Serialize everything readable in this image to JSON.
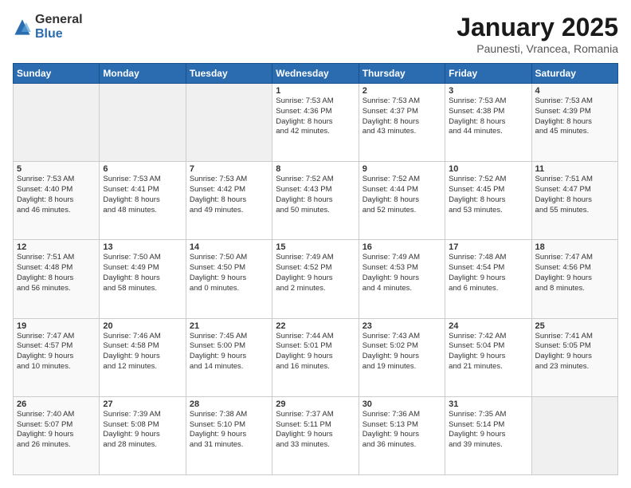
{
  "logo": {
    "general": "General",
    "blue": "Blue"
  },
  "title": {
    "month": "January 2025",
    "location": "Paunesti, Vrancea, Romania"
  },
  "weekdays": [
    "Sunday",
    "Monday",
    "Tuesday",
    "Wednesday",
    "Thursday",
    "Friday",
    "Saturday"
  ],
  "weeks": [
    [
      {
        "day": "",
        "info": ""
      },
      {
        "day": "",
        "info": ""
      },
      {
        "day": "",
        "info": ""
      },
      {
        "day": "1",
        "info": "Sunrise: 7:53 AM\nSunset: 4:36 PM\nDaylight: 8 hours\nand 42 minutes."
      },
      {
        "day": "2",
        "info": "Sunrise: 7:53 AM\nSunset: 4:37 PM\nDaylight: 8 hours\nand 43 minutes."
      },
      {
        "day": "3",
        "info": "Sunrise: 7:53 AM\nSunset: 4:38 PM\nDaylight: 8 hours\nand 44 minutes."
      },
      {
        "day": "4",
        "info": "Sunrise: 7:53 AM\nSunset: 4:39 PM\nDaylight: 8 hours\nand 45 minutes."
      }
    ],
    [
      {
        "day": "5",
        "info": "Sunrise: 7:53 AM\nSunset: 4:40 PM\nDaylight: 8 hours\nand 46 minutes."
      },
      {
        "day": "6",
        "info": "Sunrise: 7:53 AM\nSunset: 4:41 PM\nDaylight: 8 hours\nand 48 minutes."
      },
      {
        "day": "7",
        "info": "Sunrise: 7:53 AM\nSunset: 4:42 PM\nDaylight: 8 hours\nand 49 minutes."
      },
      {
        "day": "8",
        "info": "Sunrise: 7:52 AM\nSunset: 4:43 PM\nDaylight: 8 hours\nand 50 minutes."
      },
      {
        "day": "9",
        "info": "Sunrise: 7:52 AM\nSunset: 4:44 PM\nDaylight: 8 hours\nand 52 minutes."
      },
      {
        "day": "10",
        "info": "Sunrise: 7:52 AM\nSunset: 4:45 PM\nDaylight: 8 hours\nand 53 minutes."
      },
      {
        "day": "11",
        "info": "Sunrise: 7:51 AM\nSunset: 4:47 PM\nDaylight: 8 hours\nand 55 minutes."
      }
    ],
    [
      {
        "day": "12",
        "info": "Sunrise: 7:51 AM\nSunset: 4:48 PM\nDaylight: 8 hours\nand 56 minutes."
      },
      {
        "day": "13",
        "info": "Sunrise: 7:50 AM\nSunset: 4:49 PM\nDaylight: 8 hours\nand 58 minutes."
      },
      {
        "day": "14",
        "info": "Sunrise: 7:50 AM\nSunset: 4:50 PM\nDaylight: 9 hours\nand 0 minutes."
      },
      {
        "day": "15",
        "info": "Sunrise: 7:49 AM\nSunset: 4:52 PM\nDaylight: 9 hours\nand 2 minutes."
      },
      {
        "day": "16",
        "info": "Sunrise: 7:49 AM\nSunset: 4:53 PM\nDaylight: 9 hours\nand 4 minutes."
      },
      {
        "day": "17",
        "info": "Sunrise: 7:48 AM\nSunset: 4:54 PM\nDaylight: 9 hours\nand 6 minutes."
      },
      {
        "day": "18",
        "info": "Sunrise: 7:47 AM\nSunset: 4:56 PM\nDaylight: 9 hours\nand 8 minutes."
      }
    ],
    [
      {
        "day": "19",
        "info": "Sunrise: 7:47 AM\nSunset: 4:57 PM\nDaylight: 9 hours\nand 10 minutes."
      },
      {
        "day": "20",
        "info": "Sunrise: 7:46 AM\nSunset: 4:58 PM\nDaylight: 9 hours\nand 12 minutes."
      },
      {
        "day": "21",
        "info": "Sunrise: 7:45 AM\nSunset: 5:00 PM\nDaylight: 9 hours\nand 14 minutes."
      },
      {
        "day": "22",
        "info": "Sunrise: 7:44 AM\nSunset: 5:01 PM\nDaylight: 9 hours\nand 16 minutes."
      },
      {
        "day": "23",
        "info": "Sunrise: 7:43 AM\nSunset: 5:02 PM\nDaylight: 9 hours\nand 19 minutes."
      },
      {
        "day": "24",
        "info": "Sunrise: 7:42 AM\nSunset: 5:04 PM\nDaylight: 9 hours\nand 21 minutes."
      },
      {
        "day": "25",
        "info": "Sunrise: 7:41 AM\nSunset: 5:05 PM\nDaylight: 9 hours\nand 23 minutes."
      }
    ],
    [
      {
        "day": "26",
        "info": "Sunrise: 7:40 AM\nSunset: 5:07 PM\nDaylight: 9 hours\nand 26 minutes."
      },
      {
        "day": "27",
        "info": "Sunrise: 7:39 AM\nSunset: 5:08 PM\nDaylight: 9 hours\nand 28 minutes."
      },
      {
        "day": "28",
        "info": "Sunrise: 7:38 AM\nSunset: 5:10 PM\nDaylight: 9 hours\nand 31 minutes."
      },
      {
        "day": "29",
        "info": "Sunrise: 7:37 AM\nSunset: 5:11 PM\nDaylight: 9 hours\nand 33 minutes."
      },
      {
        "day": "30",
        "info": "Sunrise: 7:36 AM\nSunset: 5:13 PM\nDaylight: 9 hours\nand 36 minutes."
      },
      {
        "day": "31",
        "info": "Sunrise: 7:35 AM\nSunset: 5:14 PM\nDaylight: 9 hours\nand 39 minutes."
      },
      {
        "day": "",
        "info": ""
      }
    ]
  ]
}
